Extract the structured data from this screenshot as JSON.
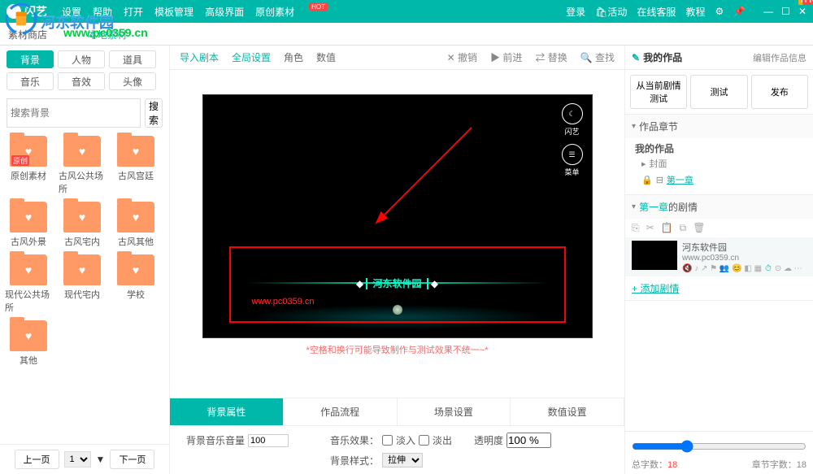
{
  "watermark": {
    "text": "河东软件园",
    "url": "www.pc0359.cn"
  },
  "topbar": {
    "logo": "闪艺",
    "menu": [
      "设置",
      "帮助",
      "打开",
      "模板管理",
      "高级界面",
      "原创素材"
    ],
    "hot_idx": 5,
    "right": {
      "login": "登录",
      "activity": "活动",
      "service": "在线客服",
      "tutorial": "教程"
    }
  },
  "tabbar": {
    "store": "素材商店",
    "local": "本地素材"
  },
  "left": {
    "tabs": [
      "背景",
      "人物",
      "道具",
      "音乐",
      "音效",
      "头像"
    ],
    "active_tab": 0,
    "search_placeholder": "搜索背景",
    "search_btn": "搜索",
    "items": [
      {
        "name": "原创素材",
        "original": true
      },
      {
        "name": "古风公共场所"
      },
      {
        "name": "古风宫廷"
      },
      {
        "name": "古风外景"
      },
      {
        "name": "古风宅内"
      },
      {
        "name": "古风其他"
      },
      {
        "name": "现代公共场所"
      },
      {
        "name": "现代宅内"
      },
      {
        "name": "学校"
      },
      {
        "name": "其他"
      }
    ],
    "pager": {
      "prev": "上一页",
      "page": "1",
      "next": "下一页"
    }
  },
  "center": {
    "toolbar": {
      "import": "导入剧本",
      "global": "全局设置",
      "role": "角色",
      "value": "数值",
      "undo": "撤销",
      "redo": "前进",
      "replace": "替换",
      "find": "查找"
    },
    "stage": {
      "app_icon_label": "闪艺",
      "menu_icon_label": "菜单",
      "title": "河东软件园",
      "url": "www.pc0359.cn"
    },
    "warn": "*空格和换行可能导致制作与测试效果不统一~*",
    "tabs": [
      "背景属性",
      "作品流程",
      "场景设置",
      "数值设置"
    ],
    "active_tab": 0,
    "settings": {
      "volume_label": "背景音乐音量",
      "volume": 100,
      "effect_label": "音乐效果：",
      "fadein": "淡入",
      "fadeout": "淡出",
      "style_label": "背景样式：",
      "style_value": "拉伸",
      "opacity_label": "透明度",
      "opacity": "100 %"
    }
  },
  "right": {
    "title": "我的作品",
    "edit": "编辑作品信息",
    "btns": [
      "从当前剧情测试",
      "测试",
      "发布"
    ],
    "chapter_section": "作品章节",
    "chapter_title": "我的作品",
    "cover": "封面",
    "chapter1": "第一章",
    "scene_section_prefix": "第一章",
    "scene_section_suffix": "的剧情",
    "scene": {
      "name": "河东软件园",
      "url": "www.pc0359.cn"
    },
    "add": "+ 添加剧情",
    "total_label": "总字数：",
    "total": "18",
    "chapter_label": "章节字数：",
    "chapter_count": "18"
  }
}
